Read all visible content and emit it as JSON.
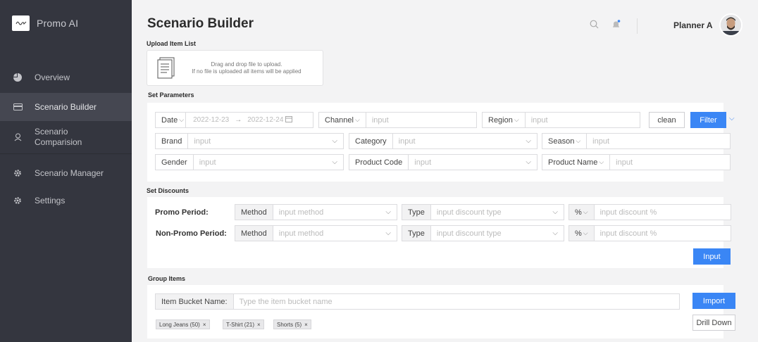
{
  "app": {
    "name": "Promo AI"
  },
  "sidebar": {
    "items": [
      {
        "label": "Overview",
        "icon": "pie-chart-icon"
      },
      {
        "label": "Scenario Builder",
        "icon": "card-icon",
        "active": true
      },
      {
        "label": "Scenario Comparision",
        "icon": "person-icon"
      },
      {
        "label": "Scenario Manager",
        "icon": "gear-icon"
      },
      {
        "label": "Settings",
        "icon": "gear-icon"
      }
    ]
  },
  "header": {
    "title": "Scenario Builder",
    "user": "Planner A"
  },
  "upload": {
    "label": "Upload Item List",
    "line1": "Drag and drop file to upload.",
    "line2": "If no file is uploaded all items will be applied"
  },
  "parameters": {
    "label": "Set Parameters",
    "date_label": "Date",
    "date_start": "2022-12-23",
    "date_arrow": "→",
    "date_end": "2022-12-24",
    "channel_label": "Channel",
    "region_label": "Region",
    "brand_label": "Brand",
    "category_label": "Category",
    "season_label": "Season",
    "gender_label": "Gender",
    "product_code_label": "Product Code",
    "product_name_label": "Product Name",
    "input_placeholder": "input",
    "clean_label": "clean",
    "filter_label": "Filter"
  },
  "discounts": {
    "label": "Set Discounts",
    "promo_label": "Promo Period:",
    "non_promo_label": "Non-Promo Period:",
    "method_label": "Method",
    "method_placeholder": "input method",
    "type_label": "Type",
    "type_placeholder": "input discount type",
    "percent_label": "%",
    "percent_placeholder": "input discount %",
    "input_button": "Input"
  },
  "group": {
    "label": "Group Items",
    "bucket_label": "Item Bucket Name:",
    "bucket_placeholder": "Type the item bucket name",
    "import_button": "Import",
    "drill_button": "Drill Down",
    "tags": [
      "Long Jeans (50)",
      "T-Shirt (21)",
      "Shorts (5)"
    ]
  },
  "colors": {
    "accent": "#3a86f5",
    "sidebar": "#34363f"
  }
}
